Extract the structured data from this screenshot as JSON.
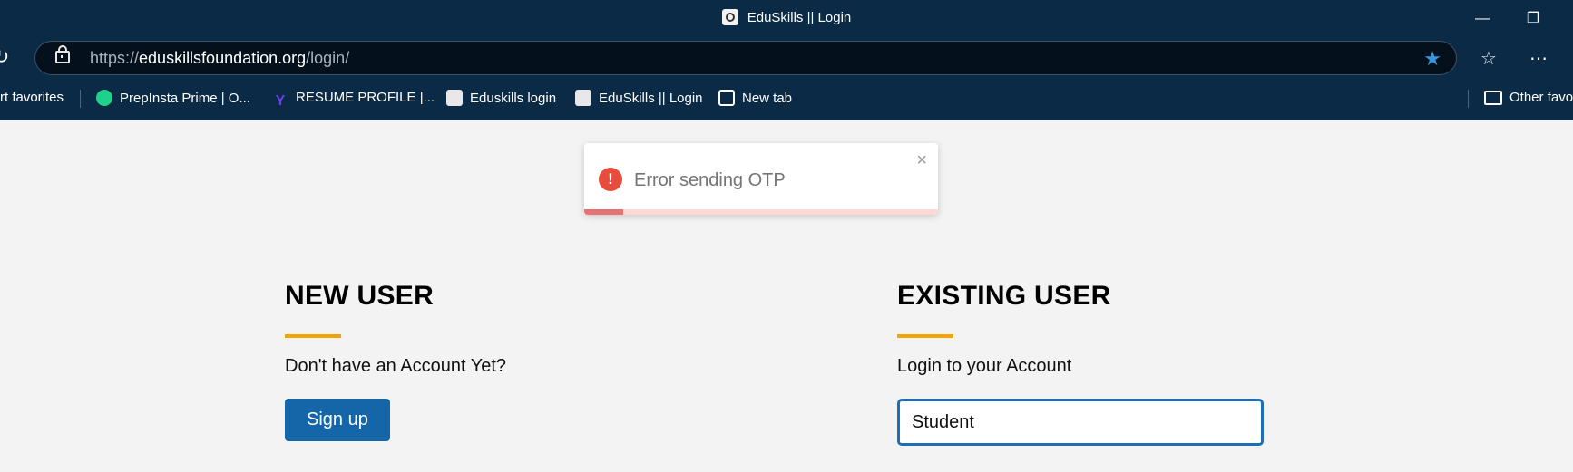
{
  "window": {
    "title": "EduSkills || Login",
    "minimize_label": "—",
    "restore_label": "❐"
  },
  "address_bar": {
    "scheme": "https://",
    "host": "eduskillsfoundation.org",
    "path": "/login/"
  },
  "toolbar": {
    "refresh_glyph": "↻",
    "star_glyph": "★",
    "favorites_glyph": "☆",
    "more_glyph": "⋯"
  },
  "bookmarks": {
    "items": [
      {
        "label": "rt favorites"
      },
      {
        "label": "PrepInsta Prime | O...",
        "icon_color": "#1fd18b"
      },
      {
        "label": "RESUME PROFILE |...",
        "icon_color": "#6a3df0"
      },
      {
        "label": "Eduskills login"
      },
      {
        "label": "EduSkills || Login"
      },
      {
        "label": "New tab"
      }
    ],
    "other": "Other favo"
  },
  "toast": {
    "message": "Error sending OTP",
    "icon": "!",
    "close": "×",
    "progress": 0.11
  },
  "new_user": {
    "heading": "NEW USER",
    "subtitle": "Don't have an Account Yet?",
    "button": "Sign up"
  },
  "existing_user": {
    "heading": "EXISTING USER",
    "subtitle": "Login to your Account",
    "role_value": "Student"
  },
  "colors": {
    "accent": "#f5a300",
    "primary": "#1466a8",
    "error": "#e74c3c",
    "chrome": "#0a2a45"
  }
}
